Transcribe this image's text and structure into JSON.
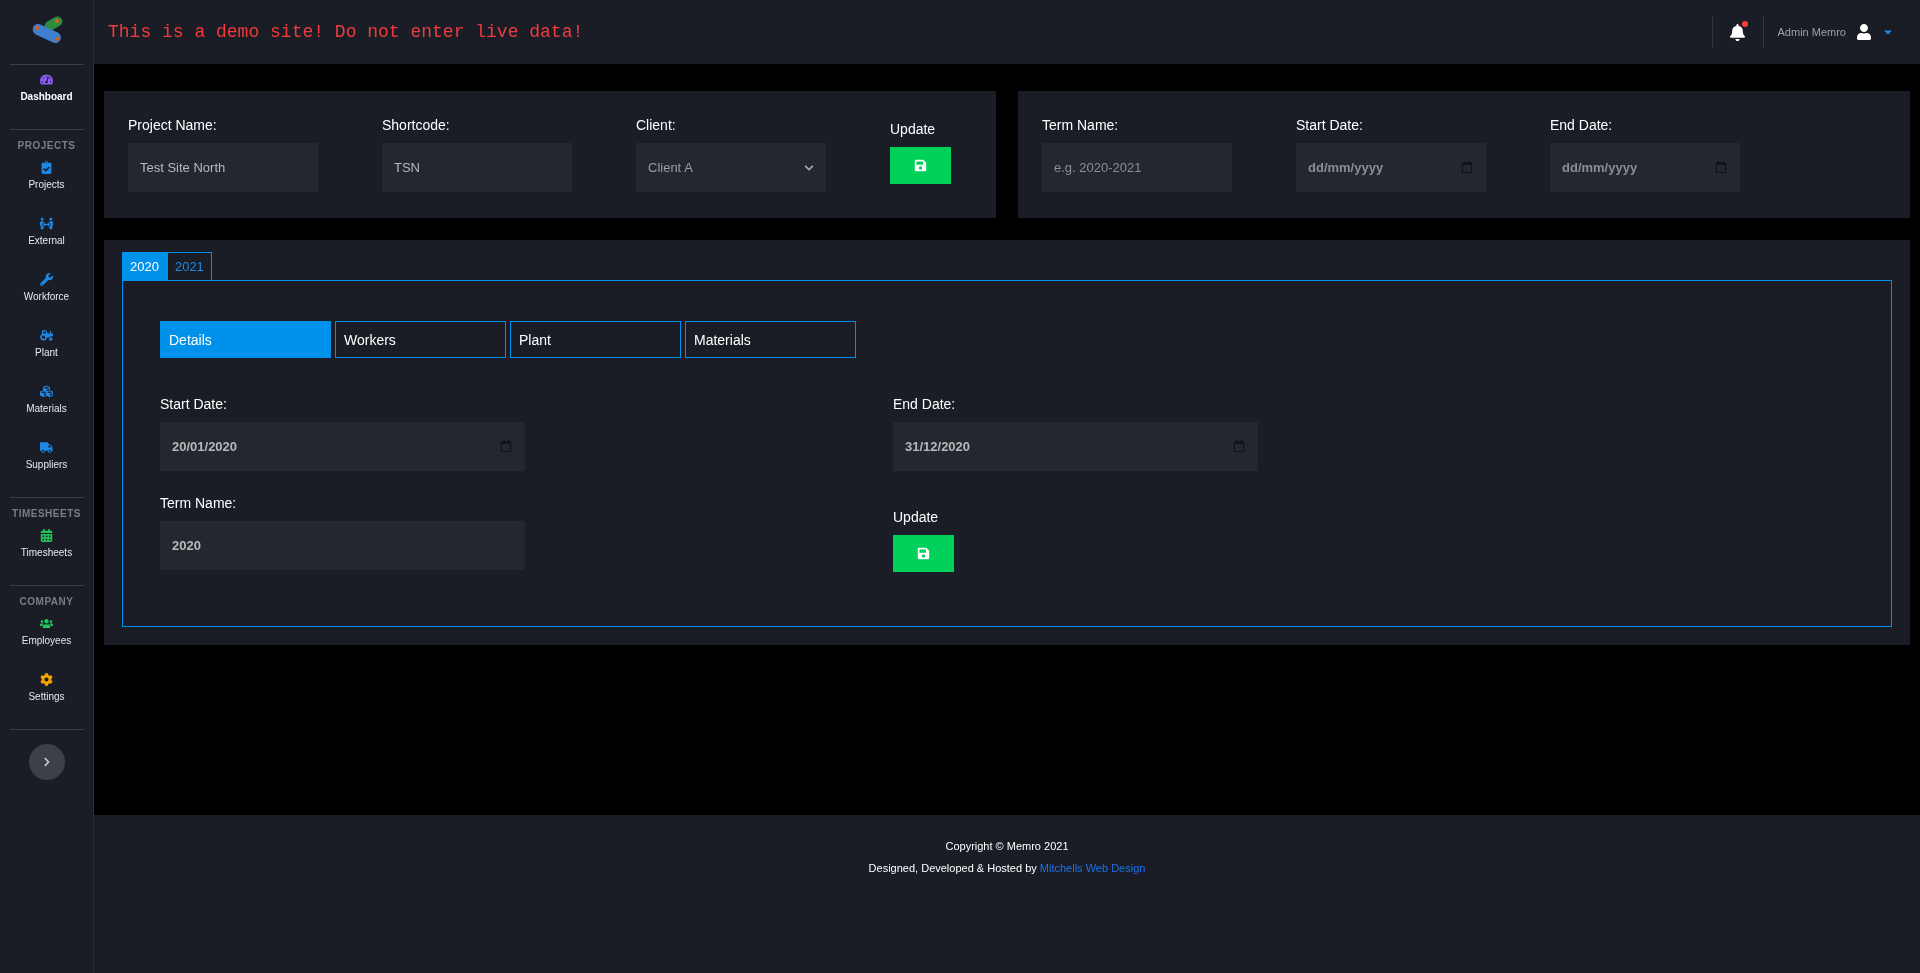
{
  "header": {
    "notice": "This is a demo site! Do not enter live data!",
    "notifications": {
      "unread": true
    },
    "user": "Admin Memro"
  },
  "sidebar": {
    "groups": [
      {
        "items": [
          {
            "label": "Dashboard",
            "selected": true,
            "color": "#8b5cf6"
          }
        ]
      },
      {
        "heading": "PROJECTS",
        "items": [
          {
            "label": "Projects",
            "selected": false,
            "color": "#1e88e5"
          },
          {
            "label": "External",
            "selected": false,
            "color": "#1e88e5"
          },
          {
            "label": "Workforce",
            "selected": false,
            "color": "#1e88e5"
          },
          {
            "label": "Plant",
            "selected": false,
            "color": "#1e88e5"
          },
          {
            "label": "Materials",
            "selected": false,
            "color": "#1e88e5"
          },
          {
            "label": "Suppliers",
            "selected": false,
            "color": "#1e88e5"
          }
        ]
      },
      {
        "heading": "TIMESHEETS",
        "items": [
          {
            "label": "Timesheets",
            "selected": false,
            "color": "#22c55e"
          }
        ]
      },
      {
        "heading": "COMPANY",
        "items": [
          {
            "label": "Employees",
            "selected": false,
            "color": "#22c55e"
          },
          {
            "label": "Settings",
            "selected": false,
            "color": "#f5a300"
          }
        ]
      }
    ]
  },
  "project_form": {
    "fields": [
      {
        "kind": "text",
        "label": "Project Name:",
        "value": "Test Site North"
      },
      {
        "kind": "text",
        "label": "Shortcode:",
        "value": "TSN"
      },
      {
        "kind": "select",
        "label": "Client:",
        "value": "Client A"
      }
    ],
    "update_label": "Update"
  },
  "term_form": {
    "fields": [
      {
        "kind": "text",
        "label": "Term Name:",
        "placeholder": "e.g. 2020-2021"
      },
      {
        "kind": "date",
        "label": "Start Date:",
        "placeholder": "dd/mm/yyyy"
      },
      {
        "kind": "date",
        "label": "End Date:",
        "placeholder": "dd/mm/yyyy"
      }
    ]
  },
  "year_tabs": [
    {
      "label": "2020",
      "selected": true
    },
    {
      "label": "2021",
      "selected": false
    }
  ],
  "section_tabs": [
    {
      "label": "Details",
      "selected": true
    },
    {
      "label": "Workers",
      "selected": false
    },
    {
      "label": "Plant",
      "selected": false
    },
    {
      "label": "Materials",
      "selected": false
    }
  ],
  "term_details": {
    "start_date": {
      "label": "Start Date:",
      "value": "20/01/2020"
    },
    "end_date": {
      "label": "End Date:",
      "value": "31/12/2020"
    },
    "term_name": {
      "label": "Term Name:",
      "value": "2020"
    },
    "update_label": "Update"
  },
  "footer": {
    "copyright": "Copyright © Memro 2021",
    "credit": "Designed, Developed & Hosted by",
    "link": "Mitchells Web Design"
  }
}
